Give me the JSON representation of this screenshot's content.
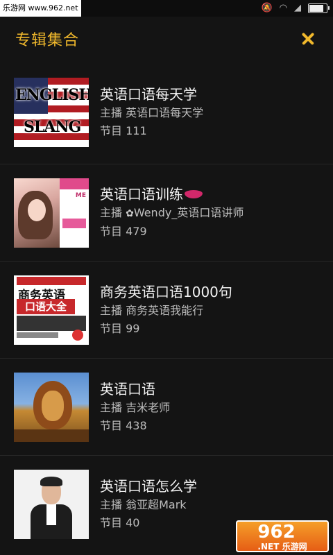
{
  "status_bar": {
    "watermark": "乐游网 www.962.net"
  },
  "header": {
    "title": "专辑集合"
  },
  "albums": [
    {
      "title": "英语口语每天学",
      "host": "主播 英语口语每天学",
      "episodes": "节目 111",
      "cover_text": [
        "ENGLISH",
        "SLANG"
      ]
    },
    {
      "title": "英语口语训练",
      "host_prefix": "主播 ",
      "host_name": "Wendy_英语口语讲师",
      "episodes": "节目 479"
    },
    {
      "title": "商务英语口语1000句",
      "host": "主播 商务英语我能行",
      "episodes": "节目 99",
      "cover_text": [
        "商务英语",
        "口语大全"
      ]
    },
    {
      "title": "英语口语",
      "host": "主播 吉米老师",
      "episodes": "节目 438"
    },
    {
      "title": "英语口语怎么学",
      "host": "主播 翁亚超Mark",
      "episodes": "节目 40"
    }
  ],
  "watermark_bottom": {
    "main": "962",
    "sub": ".NET 乐游网"
  },
  "colors": {
    "accent": "#f0b82c",
    "background": "#141414"
  }
}
